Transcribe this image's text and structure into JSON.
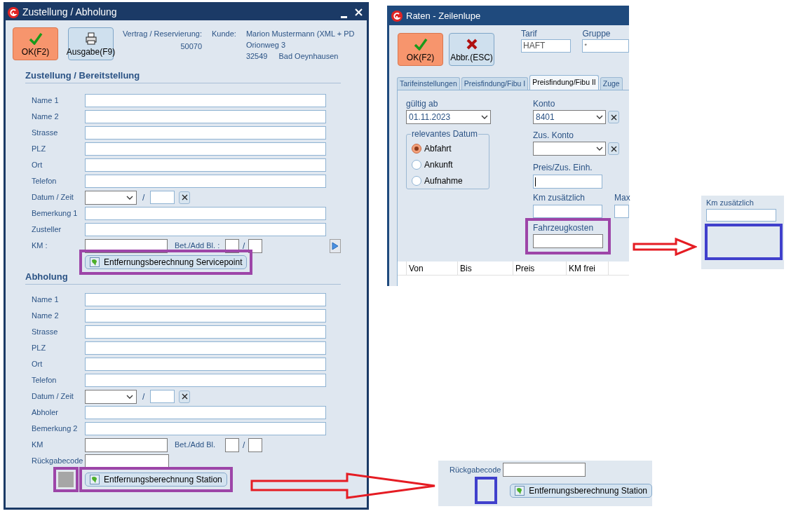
{
  "delivery_dialog": {
    "title": "Zustellung / Abholung",
    "buttons": [
      {
        "kind": "ok",
        "label": "OK(F2)"
      },
      {
        "kind": "print",
        "label": "Ausgabe(F9)"
      }
    ],
    "contract_label": "Vertrag / Reservierung:",
    "contract_number": "50070",
    "customer_label": "Kunde:",
    "customer_lines": [
      "Marion Mustermann (XML + PD",
      "Orionweg 3"
    ],
    "customer_zip": "32549",
    "customer_city": "Bad Oeynhausen",
    "sections": [
      {
        "heading": "Zustellung / Bereitstellung",
        "rows": [
          {
            "kind": "text",
            "label": "Name 1"
          },
          {
            "kind": "text",
            "label": "Name 2"
          },
          {
            "kind": "text",
            "label": "Strasse"
          },
          {
            "kind": "text",
            "label": "PLZ"
          },
          {
            "kind": "text",
            "label": "Ort"
          },
          {
            "kind": "text",
            "label": "Telefon"
          },
          {
            "kind": "datetime",
            "label": "Datum / Zeit",
            "separator": "/"
          },
          {
            "kind": "text",
            "label": "Bemerkung 1"
          },
          {
            "kind": "text",
            "label": "Zusteller"
          },
          {
            "kind": "km",
            "label": "KM :",
            "extra_label": "Bet./Add Bl. :",
            "separator": "/",
            "next_button": true
          }
        ],
        "button": {
          "label": "Entfernungsberechnung Servicepoint",
          "highlighted": true
        }
      },
      {
        "heading": "Abholung",
        "rows": [
          {
            "kind": "text",
            "label": "Name 1"
          },
          {
            "kind": "text",
            "label": "Name 2"
          },
          {
            "kind": "text",
            "label": "Strasse"
          },
          {
            "kind": "text",
            "label": "PLZ"
          },
          {
            "kind": "text",
            "label": "Ort"
          },
          {
            "kind": "text",
            "label": "Telefon"
          },
          {
            "kind": "datetime",
            "label": "Datum / Zeit",
            "separator": "/"
          },
          {
            "kind": "text",
            "label": "Abholer"
          },
          {
            "kind": "text",
            "label": "Bemerkung 2"
          },
          {
            "kind": "km",
            "label": "KM",
            "extra_label": "Bet./Add Bl.",
            "separator": "/",
            "next_button": false
          },
          {
            "kind": "short",
            "label": "Rückgabecode"
          }
        ],
        "swatch": {
          "highlighted": true
        },
        "button": {
          "label": "Entfernungsberechnung Station",
          "highlighted": true
        }
      }
    ]
  },
  "rates_dialog": {
    "title": "Raten - Zeilenlupe",
    "buttons": [
      {
        "kind": "ok",
        "label": "OK(F2)"
      },
      {
        "kind": "cancel",
        "label": "Abbr.(ESC)"
      }
    ],
    "header_fields": [
      {
        "label": "Tarif",
        "value": "HAFT"
      },
      {
        "label": "Gruppe",
        "value": "*"
      }
    ],
    "tabs": [
      {
        "label": "Tarifeinstellungen",
        "selected": false
      },
      {
        "label": "Preisfindung/Fibu I",
        "selected": false
      },
      {
        "label": "Preisfindung/Fibu II",
        "selected": true
      },
      {
        "label": "Zuge",
        "selected": false
      }
    ],
    "valid_from": {
      "label": "gültig ab",
      "value": "01.11.2023"
    },
    "date_group": {
      "legend": "relevantes Datum",
      "options": [
        {
          "label": "Abfahrt",
          "selected": true
        },
        {
          "label": "Ankunft",
          "selected": false
        },
        {
          "label": "Aufnahme",
          "selected": false
        }
      ]
    },
    "account": {
      "label": "Konto",
      "value": "8401"
    },
    "extra_account": {
      "label": "Zus. Konto"
    },
    "unit_price": {
      "label": "Preis/Zus. Einh."
    },
    "km_extra": {
      "label": "Km zusätzlich"
    },
    "max": {
      "label": "Max"
    },
    "vehicle_costs": {
      "label": "Fahrzeugkosten",
      "highlighted": true
    },
    "table": {
      "columns": [
        "Von",
        "Bis",
        "Preis",
        "KM frei"
      ]
    }
  },
  "callouts": [
    {
      "kind": "km",
      "label": "Km zusätzlich"
    },
    {
      "kind": "station",
      "label": "Rückgabecode",
      "button": "Entfernungsberechnung Station"
    }
  ]
}
